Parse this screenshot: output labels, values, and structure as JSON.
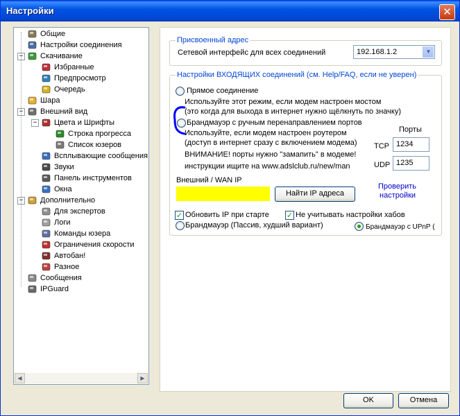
{
  "window": {
    "title": "Настройки",
    "close_glyph": "✕"
  },
  "tree": {
    "items": [
      {
        "label": "Общие",
        "icon": "general-icon",
        "level": 0
      },
      {
        "label": "Настройки соединения",
        "icon": "connection-icon",
        "level": 0
      },
      {
        "label": "Скачивание",
        "icon": "download-icon",
        "level": 0,
        "expander": "−"
      },
      {
        "label": "Избранные",
        "icon": "favorites-icon",
        "level": 1
      },
      {
        "label": "Предпросмотр",
        "icon": "preview-icon",
        "level": 1
      },
      {
        "label": "Очередь",
        "icon": "queue-icon",
        "level": 1
      },
      {
        "label": "Шара",
        "icon": "share-icon",
        "level": 0
      },
      {
        "label": "Внешний вид",
        "icon": "appearance-icon",
        "level": 0,
        "expander": "−"
      },
      {
        "label": "Цвета и Шрифты",
        "icon": "colors-icon",
        "level": 1,
        "expander": "−"
      },
      {
        "label": "Строка прогресса",
        "icon": "progress-icon",
        "level": 2
      },
      {
        "label": "Список юзеров",
        "icon": "userlist-icon",
        "level": 2
      },
      {
        "label": "Всплывающие сообщения",
        "icon": "popup-icon",
        "level": 1
      },
      {
        "label": "Звуки",
        "icon": "sound-icon",
        "level": 1
      },
      {
        "label": "Панель инструментов",
        "icon": "toolbar-icon",
        "level": 1
      },
      {
        "label": "Окна",
        "icon": "windows-icon",
        "level": 1
      },
      {
        "label": "Дополнительно",
        "icon": "advanced-icon",
        "level": 0,
        "expander": "−"
      },
      {
        "label": "Для экспертов",
        "icon": "experts-icon",
        "level": 1
      },
      {
        "label": "Логи",
        "icon": "logs-icon",
        "level": 1
      },
      {
        "label": "Команды юзера",
        "icon": "commands-icon",
        "level": 1
      },
      {
        "label": "Ограничения скорости",
        "icon": "speed-limit-icon",
        "level": 1
      },
      {
        "label": "Автобан!",
        "icon": "autoban-icon",
        "level": 1
      },
      {
        "label": "Разное",
        "icon": "misc-icon",
        "level": 1
      },
      {
        "label": "Сообщения",
        "icon": "messages-icon",
        "level": 0
      },
      {
        "label": "IPGuard",
        "icon": "ipguard-icon",
        "level": 0
      }
    ],
    "scroll_left": "◀",
    "scroll_right": "▶"
  },
  "assigned": {
    "legend": "Присвоенный адрес",
    "label": "Сетевой интерфейс для всех соединений",
    "value": "192.168.1.2",
    "arrow": "▼"
  },
  "incoming": {
    "legend": "Настройки ВХОДЯЩИХ соединений (см. Help/FAQ, если не уверен)",
    "direct_label": "Прямое соединение",
    "direct_desc1": "Используйте этот режим, если модем настроен мостом",
    "direct_desc2": "(это когда для выхода в интернет нужно щёлкнуть по значку)",
    "firewall_label": "Брандмауэр с ручным перенаправлением портов",
    "firewall_desc1": "Используйте, если модем настроен роутером",
    "firewall_desc2": "(доступ в интернет сразу с включением модема)",
    "warning1": "ВНИМАНИЕ! порты нужно \"замапить\" в модеме!",
    "warning2": "инструкции ищите на www.adslclub.ru/new/man",
    "ports_label": "Порты",
    "tcp_label": "TCP",
    "tcp_value": "1234",
    "udp_label": "UDP",
    "udp_value": "1235",
    "wan_label": "Внешний / WAN IP",
    "wan_value": "",
    "find_ip_button": "Найти IP адреса",
    "check_link_line1": "Проверить",
    "check_link_line2": "настройки",
    "update_ip_label": "Обновить IP при старте",
    "ignore_hubs_label": "Не учитывать настройки хабов",
    "passive_label": "Брандмауэр (Пассив, худший вариант)",
    "upnp_label": "Брандмауэр с UPnP (",
    "check_glyph": "✓",
    "colors": {
      "highlight": "#ffff00",
      "annotation": "#0000ff",
      "link": "#0000cc"
    }
  },
  "footer": {
    "ok": "OK",
    "cancel": "Отмена"
  }
}
